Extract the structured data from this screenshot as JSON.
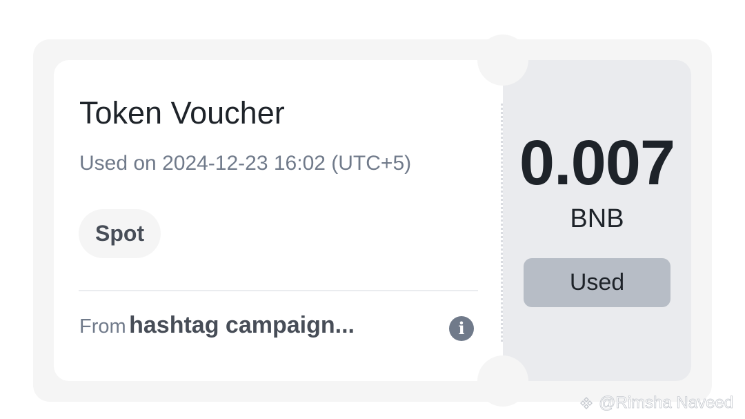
{
  "voucher": {
    "title": "Token Voucher",
    "used_on": "Used on 2024-12-23 16:02 (UTC+5)",
    "tag": "Spot",
    "from_label": "From",
    "from_source": "hashtag campaign...",
    "info_icon": "info-icon",
    "amount": "0.007",
    "currency": "BNB",
    "status": "Used"
  },
  "watermark": {
    "text": "@Rimsha Naveed",
    "logo_icon": "binance-logo"
  },
  "colors": {
    "card_background": "#f5f5f5",
    "amount_panel": "#eaebee",
    "status_button": "#b7bdc6",
    "primary_text": "#1e2329",
    "secondary_text": "#707a8a"
  }
}
